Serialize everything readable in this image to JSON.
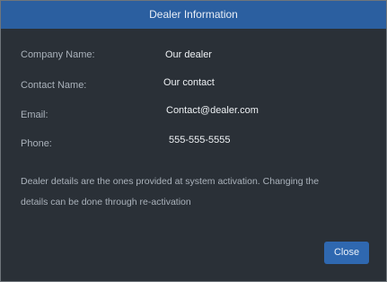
{
  "dialog": {
    "title": "Dealer Information",
    "fields": [
      {
        "label": "Company Name:",
        "value": "Our dealer"
      },
      {
        "label": "Contact Name:",
        "value": "Our contact"
      },
      {
        "label": "Email:",
        "value": "Contact@dealer.com"
      },
      {
        "label": "Phone:",
        "value": "555-555-5555"
      }
    ],
    "note": "Dealer details are the ones provided at system activation. Changing the details can be done through re-activation",
    "close_label": "Close"
  },
  "colors": {
    "title_bar": "#2b5fa0",
    "background": "#2a3037",
    "button": "#2f68b0"
  }
}
